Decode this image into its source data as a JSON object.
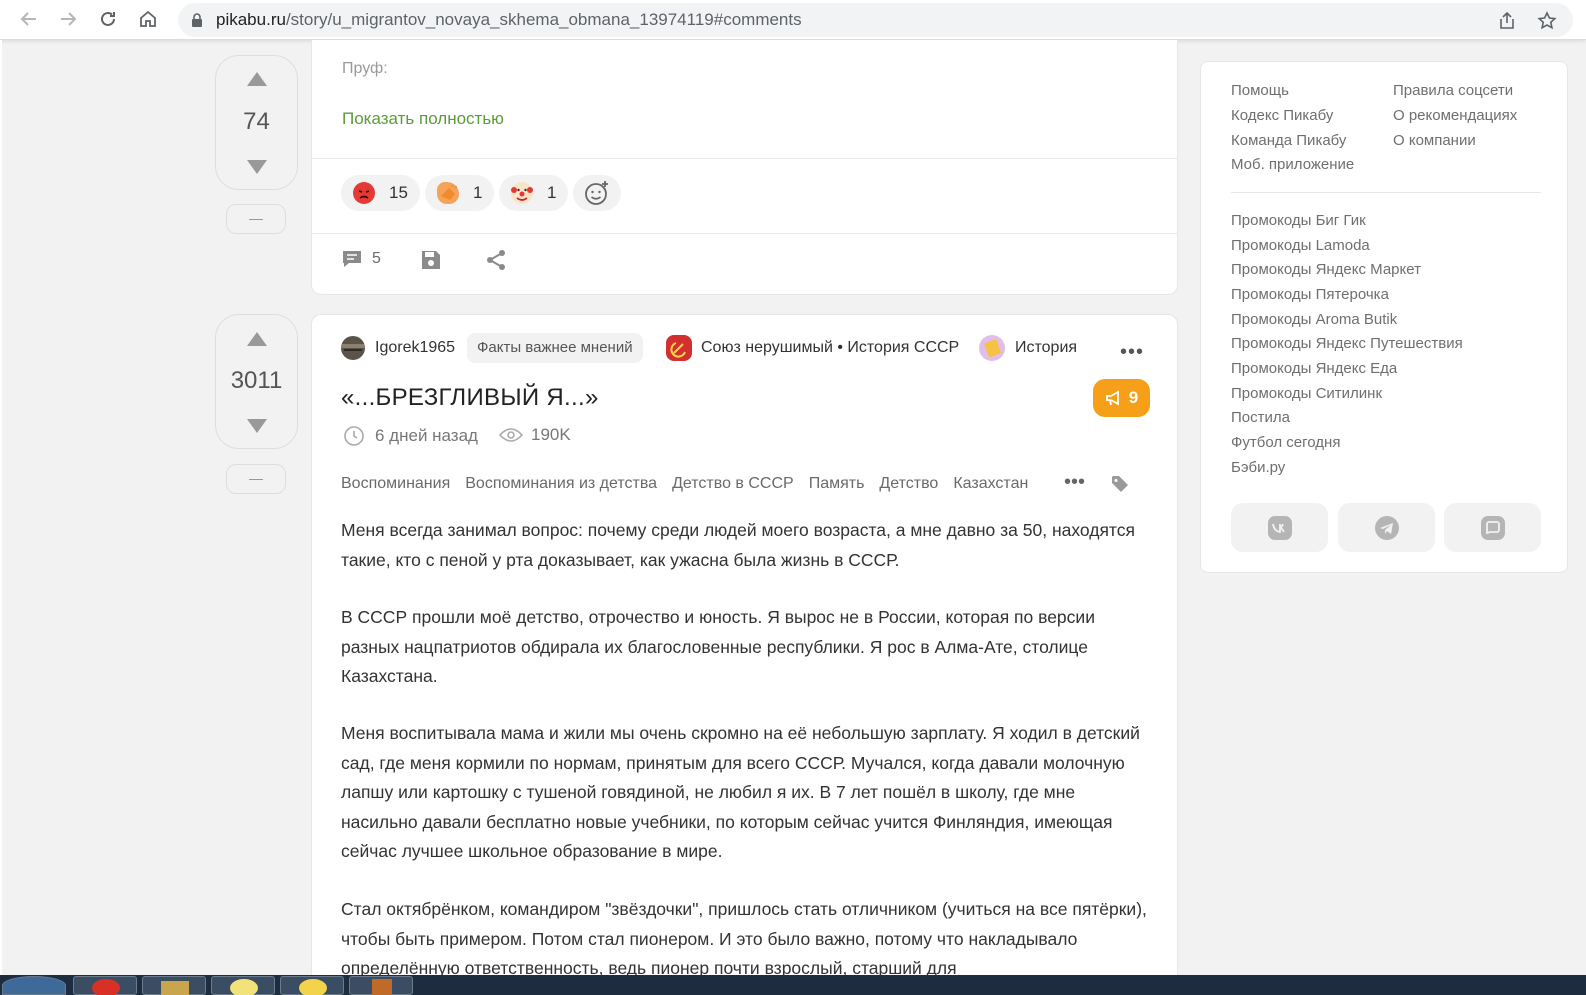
{
  "browser": {
    "url_host": "pikabu.ru",
    "url_path": "/story/u_migrantov_novaya_skhema_obmana_13974119#comments"
  },
  "prev_post": {
    "votes": "74",
    "proof_label": "Пруф:",
    "show_full_label": "Показать полностью",
    "reactions": [
      {
        "name": "angry",
        "count": "15"
      },
      {
        "name": "clap",
        "count": "1"
      },
      {
        "name": "clown",
        "count": "1"
      }
    ],
    "comments_count": "5"
  },
  "story": {
    "votes": "3011",
    "author": "Igorek1965",
    "author_badge": "Факты важнее мнений",
    "community": "Союз нерушимый • История СССР",
    "community2": "История",
    "title": "«...БРЕЗГЛИВЫЙ Я...»",
    "rating": "9",
    "time": "6 дней назад",
    "views": "190K",
    "tags": [
      "Воспоминания",
      "Воспоминания из детства",
      "Детство в СССР",
      "Память",
      "Детство",
      "Казахстан"
    ],
    "paragraphs": [
      "Меня всегда занимал вопрос: почему среди людей моего возраста, а мне давно за 50, находятся такие, кто с пеной у рта доказывает, как ужасна была жизнь в СССР.",
      "В СССР прошли моё детство, отрочество и юность. Я вырос не в России, которая по версии разных нацпатриотов обдирала их благословенные республики. Я рос в Алма-Ате, столице Казахстана.",
      "Меня воспитывала мама и жили мы очень скромно на её небольшую зарплату. Я ходил в детский сад, где меня кормили по нормам, принятым для всего СССР. Мучался, когда давали молочную лапшу или картошку с тушеной говядиной, не любил я их. В 7 лет пошёл в школу, где мне насильно давали бесплатно новые учебники, по которым сейчас учится Финляндия, имеющая сейчас лучшее школьное образование в мире.",
      "Стал октябрёнком, командиром \"звёздочки\", пришлось стать отличником (учиться на все пятёрки), чтобы быть примером. Потом стал пионером. И это было важно, потому что накладывало определённую ответственность, ведь пионер почти взрослый, старший для"
    ]
  },
  "sidebar": {
    "col1": [
      "Помощь",
      "Кодекс Пикабу",
      "Команда Пикабу",
      "Моб. приложение"
    ],
    "col2": [
      "Правила соцсети",
      "О рекомендациях",
      "О компании"
    ],
    "promos": [
      "Промокоды Биг Гик",
      "Промокоды Lamoda",
      "Промокоды Яндекс Маркет",
      "Промокоды Пятерочка",
      "Промокоды Aroma Butik",
      "Промокоды Яндекс Путешествия",
      "Промокоды Яндекс Еда",
      "Промокоды Ситилинк",
      "Постила",
      "Футбол сегодня",
      "Бэби.ру"
    ]
  },
  "colors": {
    "accent_green": "#5b9c3a",
    "rating_orange": "#f6a01a"
  }
}
